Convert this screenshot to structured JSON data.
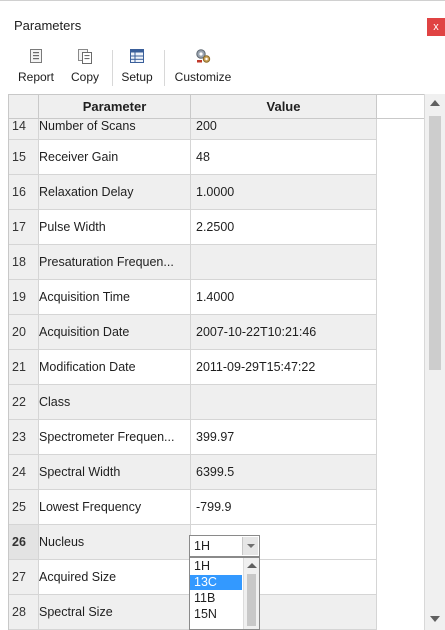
{
  "window": {
    "title": "Parameters",
    "close_glyph": "x"
  },
  "toolbar": {
    "buttons": [
      {
        "label": "Report",
        "icon": "report-icon"
      },
      {
        "label": "Copy",
        "icon": "copy-icon"
      },
      {
        "label": "Setup",
        "icon": "setup-icon"
      },
      {
        "label": "Customize",
        "icon": "customize-icon"
      }
    ]
  },
  "table": {
    "columns": [
      "Parameter",
      "Value"
    ],
    "rows": [
      {
        "idx": "14",
        "name": "Number of Scans",
        "value": "200"
      },
      {
        "idx": "15",
        "name": "Receiver Gain",
        "value": "48"
      },
      {
        "idx": "16",
        "name": "Relaxation Delay",
        "value": "1.0000"
      },
      {
        "idx": "17",
        "name": "Pulse Width",
        "value": "2.2500"
      },
      {
        "idx": "18",
        "name": "Presaturation Frequen...",
        "value": ""
      },
      {
        "idx": "19",
        "name": "Acquisition Time",
        "value": "1.4000"
      },
      {
        "idx": "20",
        "name": "Acquisition Date",
        "value": "2007-10-22T10:21:46"
      },
      {
        "idx": "21",
        "name": "Modification Date",
        "value": "2011-09-29T15:47:22"
      },
      {
        "idx": "22",
        "name": "Class",
        "value": ""
      },
      {
        "idx": "23",
        "name": "Spectrometer Frequen...",
        "value": "399.97"
      },
      {
        "idx": "24",
        "name": "Spectral Width",
        "value": "6399.5"
      },
      {
        "idx": "25",
        "name": "Lowest Frequency",
        "value": "-799.9"
      },
      {
        "idx": "26",
        "name": "Nucleus",
        "value": ""
      },
      {
        "idx": "27",
        "name": "Acquired Size",
        "value": ""
      },
      {
        "idx": "28",
        "name": "Spectral Size",
        "value": ""
      }
    ]
  },
  "nucleus_dropdown": {
    "current": "1H",
    "options": [
      "1H",
      "13C",
      "11B",
      "15N"
    ],
    "highlighted": "13C"
  }
}
